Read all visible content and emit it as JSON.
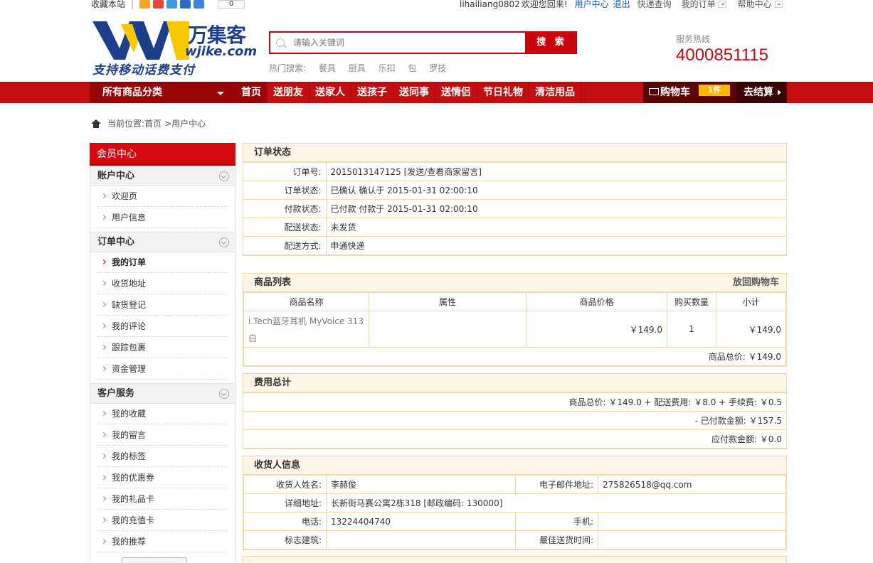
{
  "topbar": {
    "favorite": "收藏本站",
    "separator": "|",
    "share_count": "0",
    "username": "lihailiang0802",
    "welcome": "欢迎您回来!",
    "user_center": "用户中心",
    "logout": "退出",
    "quick_query": "快递查询",
    "my_orders": "我的订单",
    "help_center": "帮助中心"
  },
  "header": {
    "brand": "万集客",
    "domain": "wjike.com",
    "slogan": "支持移动话费支付",
    "search_placeholder": "请输入关键词",
    "search_button": "搜 索",
    "hot_label": "热门搜索:",
    "hot_terms": [
      "餐具",
      "厨具",
      "乐扣",
      "包",
      "罗技"
    ],
    "hotline_label": "服务热线",
    "hotline": "4000851115"
  },
  "nav": {
    "all_categories": "所有商品分类",
    "items": [
      "首页",
      "送朋友",
      "送家人",
      "送孩子",
      "送同事",
      "送情侣",
      "节日礼物",
      "清洁用品"
    ],
    "cart": "购物车",
    "cart_count": "1件",
    "checkout": "去结算"
  },
  "breadcrumb": {
    "prefix": "当前位置:",
    "home": "首页",
    "current": ">用户中心"
  },
  "sidebar": {
    "title": "会员中心",
    "groups": [
      {
        "label": "账户中心",
        "links": [
          "欢迎页",
          "用户信息"
        ]
      },
      {
        "label": "订单中心",
        "links": [
          "我的订单",
          "收货地址",
          "缺货登记",
          "我的评论",
          "跟踪包裹",
          "资金管理"
        ]
      },
      {
        "label": "客户服务",
        "links": [
          "我的收藏",
          "我的留言",
          "我的标签",
          "我的优惠券",
          "我的礼品卡",
          "我的充值卡",
          "我的推荐"
        ]
      }
    ]
  },
  "order_status": {
    "title": "订单状态",
    "rows": [
      {
        "label": "订单号:",
        "value": "2015013147125 [发送/查看商家留言]"
      },
      {
        "label": "订单状态:",
        "value": "已确认   确认于 2015-01-31 02:00:10"
      },
      {
        "label": "付款状态:",
        "value": "已付款   付款于 2015-01-31 02:00:10"
      },
      {
        "label": "配送状态:",
        "value": "未发货"
      },
      {
        "label": "配送方式:",
        "value": "申通快递"
      }
    ]
  },
  "goods": {
    "title": "商品列表",
    "back_to_cart": "放回购物车",
    "headers": [
      "商品名称",
      "属性",
      "商品价格",
      "购买数量",
      "小计"
    ],
    "rows": [
      {
        "name": "i.Tech蓝牙耳机 MyVoice 313 白",
        "attr": "",
        "price": "￥149.0",
        "qty": "1",
        "subtotal": "￥149.0"
      }
    ],
    "total": "商品总价: ￥149.0"
  },
  "fees": {
    "title": "费用总计",
    "line1": "商品总价: ￥149.0 + 配送费用: ￥8.0 + 手续费: ￥0.5",
    "line2": "- 已付款金额: ￥157.5",
    "line3": "应付款金额: ￥0.0"
  },
  "receiver": {
    "title": "收货人信息",
    "name_label": "收货人姓名:",
    "name": "李赫俊",
    "email_label": "电子邮件地址:",
    "email": "275826518@qq.com",
    "address_label": "详细地址:",
    "address": "长新街马赛公寓2栋318 [邮政编码: 130000]",
    "phone_label": "电话:",
    "phone": "13224404740",
    "mobile_label": "手机:",
    "mobile": "",
    "landmark_label": "标志建筑:",
    "landmark": "",
    "best_time_label": "最佳送货时间:",
    "best_time": ""
  },
  "colors": {
    "brand_red": "#c8060d",
    "nav_red": "#c30d0e",
    "link_blue": "#1a5ea6",
    "panel_border": "#f0d8a8",
    "panel_title_bg": "#fdf6e6"
  }
}
